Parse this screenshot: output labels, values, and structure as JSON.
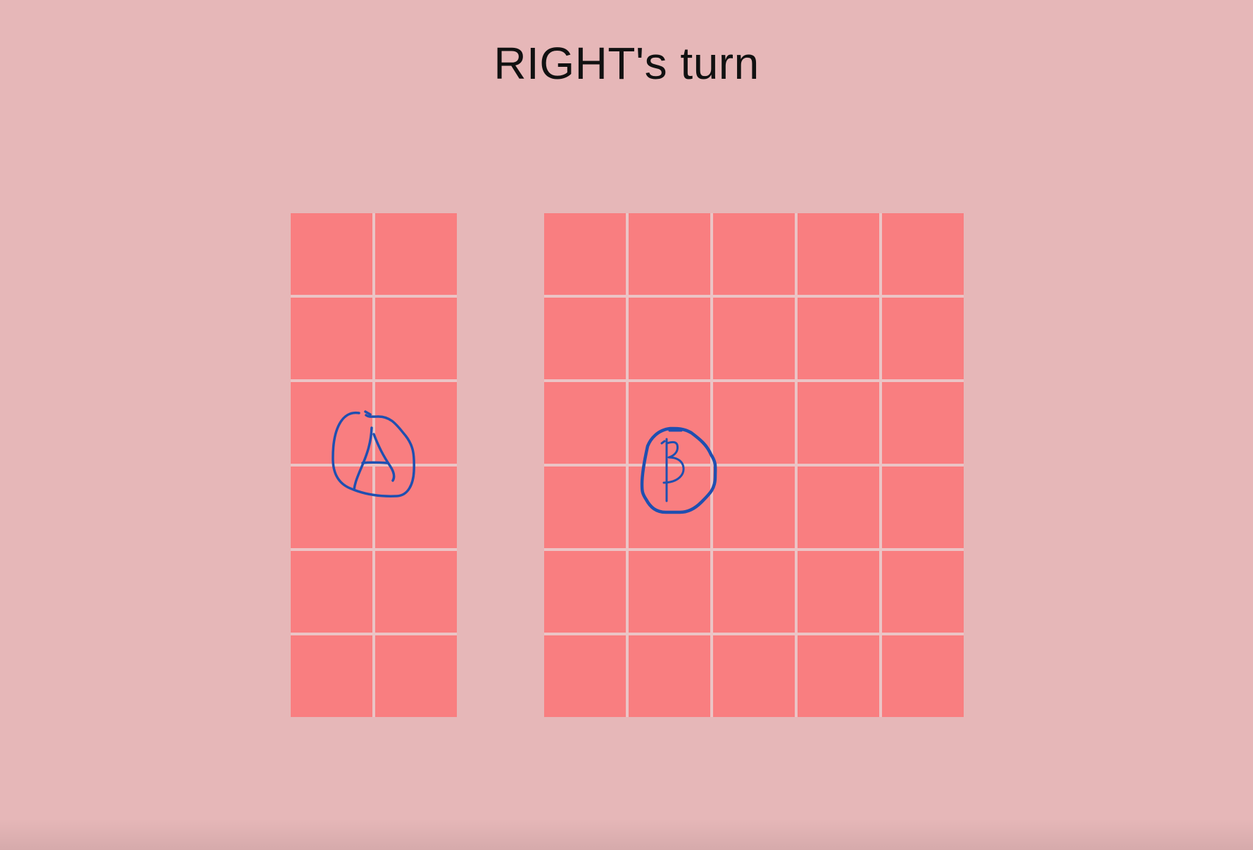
{
  "status": {
    "turn_text": "RIGHT's turn"
  },
  "boards": {
    "left": {
      "columns": 2,
      "rows": 6,
      "marker": {
        "label": "A",
        "cell": {
          "col": 1,
          "row": 3
        }
      }
    },
    "right": {
      "columns": 5,
      "rows": 6,
      "marker": {
        "label": "B",
        "cell": {
          "col": 2,
          "row": 3
        }
      }
    }
  },
  "colors": {
    "background": "#e6b7b8",
    "cell": "#f97e80",
    "grid_line": "#ebc4c5",
    "marker_ink": "#1f4fb0",
    "title_text": "#111111"
  }
}
